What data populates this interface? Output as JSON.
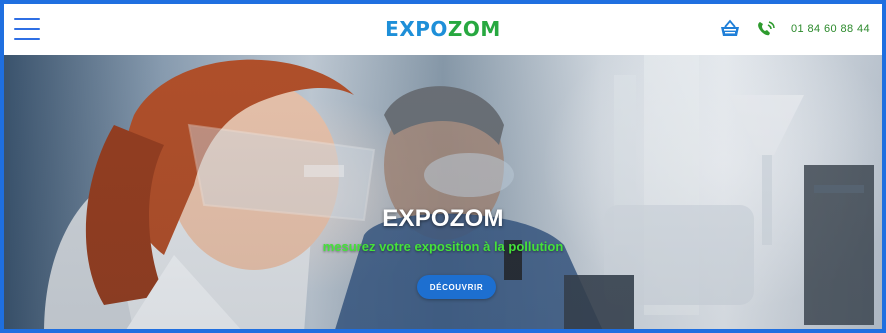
{
  "header": {
    "logo_part1": "EXPO",
    "logo_part2": "ZOM",
    "menu_icon": "hamburger-icon",
    "cart_icon": "basket-icon",
    "phone_icon": "phone-icon",
    "phone_number": "01 84 60 88 44"
  },
  "hero": {
    "title": "EXPOZOM",
    "subtitle": "mesurez votre exposition à la pollution",
    "cta_label": "DÉCOUVRIR",
    "image_description_icon": "laboratory-photo"
  },
  "colors": {
    "border": "#1f6fe0",
    "logo_blue": "#1e8fd8",
    "logo_green": "#27a840",
    "phone_green": "#2c8a2c",
    "subtitle_green": "#45e23a",
    "button_blue": "#1d6fd0"
  }
}
